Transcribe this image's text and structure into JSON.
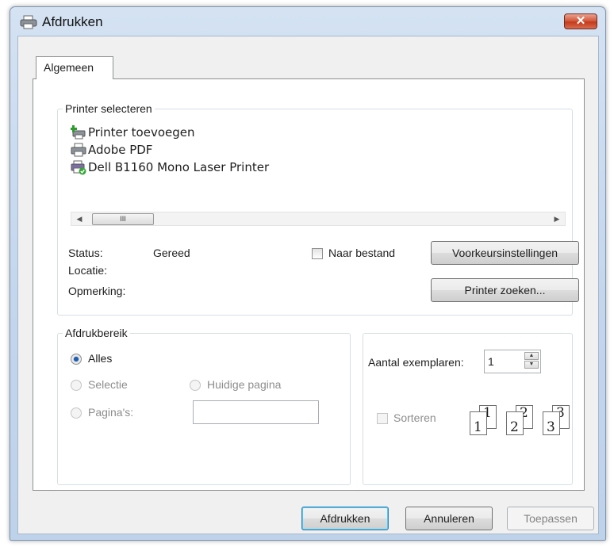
{
  "window": {
    "title": "Afdrukken",
    "close_label": "✕"
  },
  "tab": {
    "label": "Algemeen"
  },
  "printer_group": {
    "legend": "Printer selecteren",
    "printers": [
      "Printer toevoegen",
      "Adobe PDF",
      "Dell B1160 Mono Laser Printer"
    ],
    "scroll_thumb": "III",
    "status_label": "Status:",
    "status_value": "Gereed",
    "location_label": "Locatie:",
    "comment_label": "Opmerking:",
    "to_file_label": "Naar bestand",
    "preferences_button": "Voorkeursinstellingen",
    "find_printer_button": "Printer zoeken..."
  },
  "range_group": {
    "legend": "Afdrukbereik",
    "all": "Alles",
    "selection": "Selectie",
    "current_page": "Huidige pagina",
    "pages": "Pagina's:",
    "pages_value": ""
  },
  "copies_group": {
    "copies_label": "Aantal exemplaren:",
    "copies_value": "1",
    "collate_label": "Sorteren",
    "collate_pages": [
      "1",
      "1",
      "2",
      "2",
      "3",
      "3"
    ]
  },
  "buttons": {
    "print": "Afdrukken",
    "cancel": "Annuleren",
    "apply": "Toepassen"
  }
}
